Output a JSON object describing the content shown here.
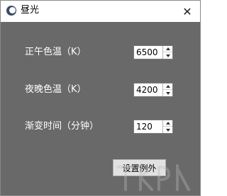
{
  "window": {
    "title": "昼光",
    "close_glyph": "✕"
  },
  "settings": {
    "day_temp": {
      "label": "正午色温（K）",
      "value": "6500"
    },
    "night_temp": {
      "label": "夜晚色温（K）",
      "value": "4200"
    },
    "transition": {
      "label": "渐变时间（分钟）",
      "value": "120"
    }
  },
  "actions": {
    "exception_label": "设置例外"
  },
  "colors": {
    "background": "#696969",
    "titlebar": "#ffffff",
    "label_text": "#ffffff"
  },
  "icons": {
    "app": "app-icon",
    "close": "close-icon",
    "spin_up": "spin-up-icon",
    "spin_down": "spin-down-icon"
  }
}
